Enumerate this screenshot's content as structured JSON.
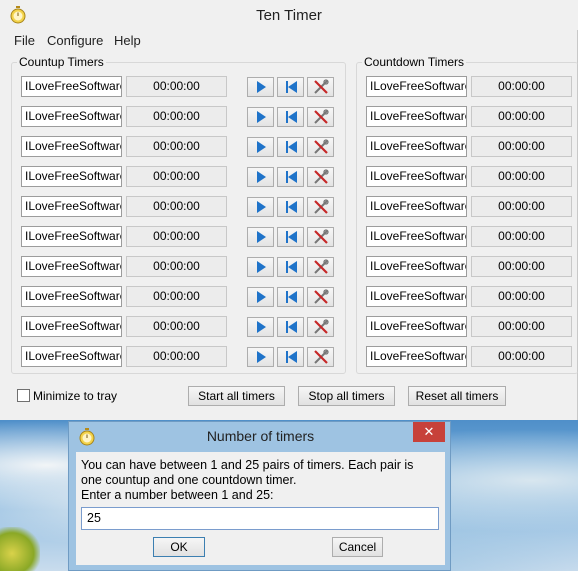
{
  "window": {
    "title": "Ten Timer"
  },
  "menu": [
    "File",
    "Configure",
    "Help"
  ],
  "countup": {
    "label": "Countup Timers",
    "rows": [
      {
        "name": "ILoveFreeSoftware",
        "time": "00:00:00"
      },
      {
        "name": "ILoveFreeSoftware",
        "time": "00:00:00"
      },
      {
        "name": "ILoveFreeSoftware",
        "time": "00:00:00"
      },
      {
        "name": "ILoveFreeSoftware",
        "time": "00:00:00"
      },
      {
        "name": "ILoveFreeSoftware",
        "time": "00:00:00"
      },
      {
        "name": "ILoveFreeSoftware",
        "time": "00:00:00"
      },
      {
        "name": "ILoveFreeSoftware",
        "time": "00:00:00"
      },
      {
        "name": "ILoveFreeSoftware",
        "time": "00:00:00"
      },
      {
        "name": "ILoveFreeSoftware",
        "time": "00:00:00"
      },
      {
        "name": "ILoveFreeSoftware",
        "time": "00:00:00"
      }
    ]
  },
  "countdown": {
    "label": "Countdown Timers",
    "rows": [
      {
        "name": "ILoveFreeSoftware",
        "time": "00:00:00"
      },
      {
        "name": "ILoveFreeSoftware",
        "time": "00:00:00"
      },
      {
        "name": "ILoveFreeSoftware",
        "time": "00:00:00"
      },
      {
        "name": "ILoveFreeSoftware",
        "time": "00:00:00"
      },
      {
        "name": "ILoveFreeSoftware",
        "time": "00:00:00"
      },
      {
        "name": "ILoveFreeSoftware",
        "time": "00:00:00"
      },
      {
        "name": "ILoveFreeSoftware",
        "time": "00:00:00"
      },
      {
        "name": "ILoveFreeSoftware",
        "time": "00:00:00"
      },
      {
        "name": "ILoveFreeSoftware",
        "time": "00:00:00"
      },
      {
        "name": "ILoveFreeSoftware",
        "time": "00:00:00"
      }
    ]
  },
  "icons": {
    "play": "play-icon",
    "reset": "skip-to-start-icon",
    "config": "tools-icon",
    "app": "stopwatch-icon"
  },
  "colors": {
    "play": "#1f73c9",
    "reset": "#1f73c9",
    "tools_red": "#c62828",
    "close": "#c7413a",
    "dialog_frame": "#9ec3e2"
  },
  "footer": {
    "minimize_label": "Minimize to tray",
    "minimize_checked": false,
    "start_all": "Start all timers",
    "stop_all": "Stop all timers",
    "reset_all": "Reset all timers"
  },
  "dialog": {
    "title": "Number of timers",
    "close": "✕",
    "line1": "You can have between 1 and 25 pairs of timers.  Each pair is",
    "line2": "one countup and one countdown timer.",
    "line3": "Enter a number between 1 and 25:",
    "value": "25",
    "ok": "OK",
    "cancel": "Cancel"
  }
}
